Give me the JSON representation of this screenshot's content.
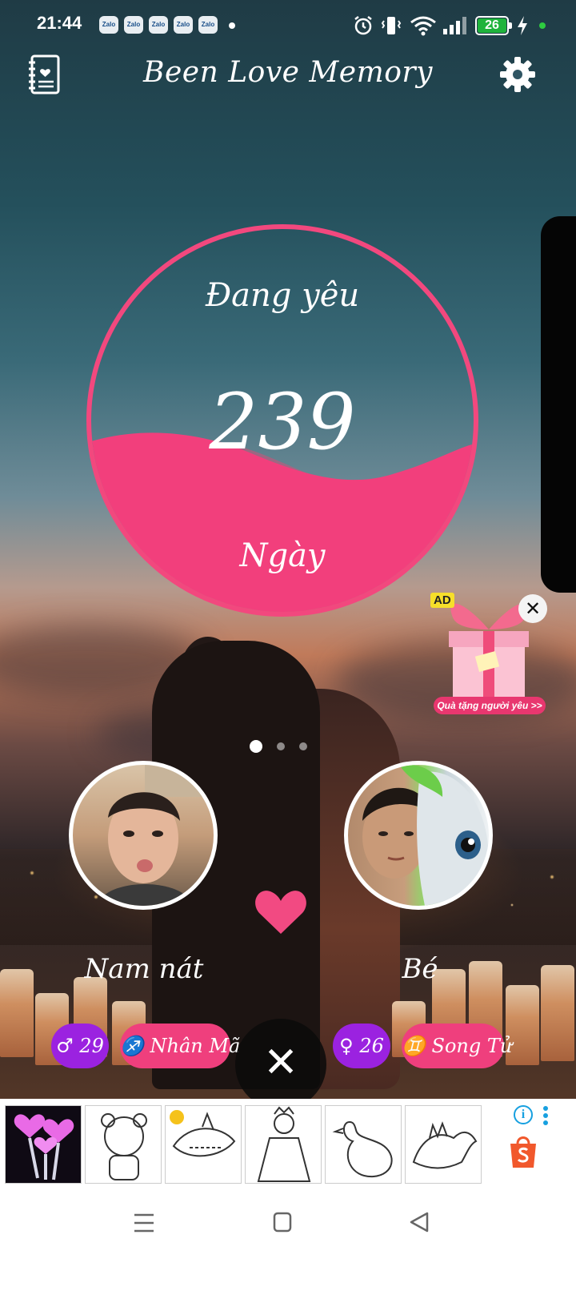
{
  "status_bar": {
    "time": "21:44",
    "notification_apps": [
      "Zalo",
      "Zalo",
      "Zalo",
      "Zalo",
      "Zalo"
    ],
    "battery_level": "26",
    "icons": [
      "alarm-icon",
      "vibrate-icon",
      "wifi-icon",
      "signal-icon",
      "battery-icon",
      "charging-icon"
    ]
  },
  "header": {
    "title": "Been Love Memory",
    "left_icon": "journal-heart-icon",
    "right_icon": "gear-icon"
  },
  "counter": {
    "status_label": "Đang yêu",
    "days": "239",
    "unit_label": "Ngày",
    "accent_color": "#f2487e"
  },
  "ad_gift": {
    "badge": "AD",
    "caption": "Quà tặng người yêu >>"
  },
  "pager": {
    "pages": 3,
    "active": 0
  },
  "partners": {
    "left": {
      "name": "Nam nát",
      "gender_icon": "♂",
      "age": "29",
      "zodiac_icon": "♐",
      "zodiac": "Nhân Mã"
    },
    "right": {
      "name": "Bé",
      "gender_icon": "♀",
      "age": "26",
      "zodiac_icon": "♊",
      "zodiac": "Song Tử"
    }
  },
  "close_button": "✕",
  "ad_banner": {
    "brand_icon": "shopee-icon"
  },
  "colors": {
    "pink": "#ef3f7d",
    "purple": "#9b22e0"
  }
}
